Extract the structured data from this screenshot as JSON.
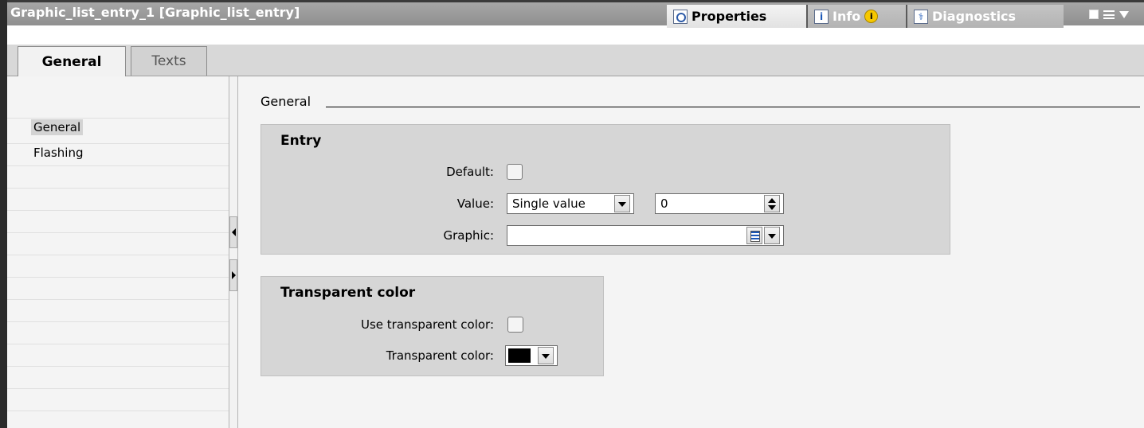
{
  "window": {
    "title": "Graphic_list_entry_1 [Graphic_list_entry]",
    "tabs": {
      "properties": "Properties",
      "info": "Info",
      "diagnostics": "Diagnostics"
    }
  },
  "subtabs": {
    "general": "General",
    "texts": "Texts"
  },
  "nav": {
    "items": [
      "General",
      "Flashing"
    ],
    "selected": "General"
  },
  "main": {
    "section_title": "General",
    "entry": {
      "title": "Entry",
      "default_label": "Default:",
      "default_checked": false,
      "value_label": "Value:",
      "value_mode": "Single value",
      "value": "0",
      "graphic_label": "Graphic:",
      "graphic_value": ""
    },
    "transparent": {
      "title": "Transparent color",
      "use_label": "Use transparent color:",
      "use_checked": false,
      "color_label": "Transparent color:",
      "color": "#000000"
    }
  },
  "colors": {
    "title_bar": "#9a9a9a",
    "panel_bg": "#f4f4f4",
    "group_bg": "#d6d6d6",
    "selected_nav": "#d3d3d3"
  }
}
